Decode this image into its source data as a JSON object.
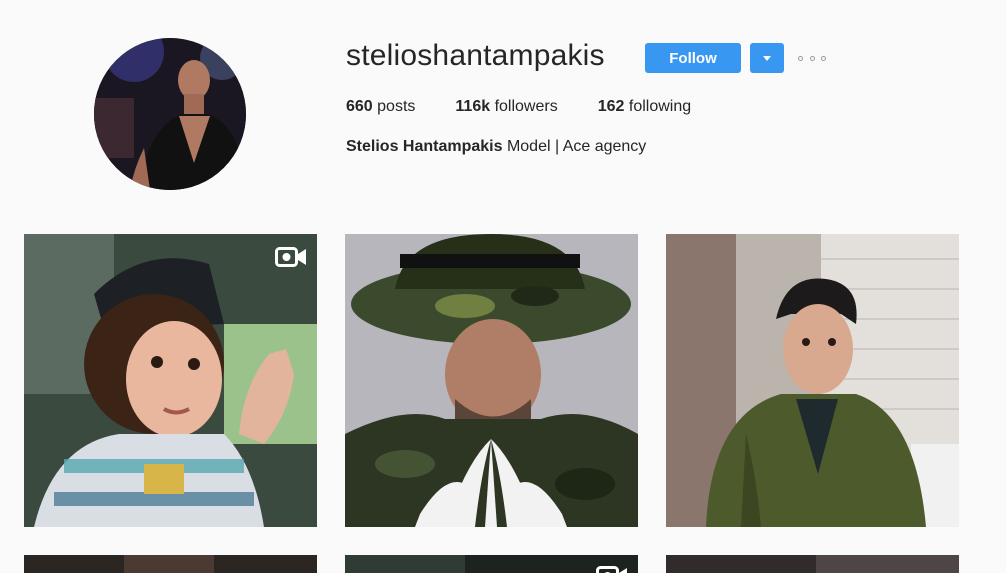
{
  "profile": {
    "username": "stelioshantampakis",
    "follow_label": "Follow",
    "posts_count": "660",
    "posts_label": "posts",
    "followers_count": "116k",
    "followers_label": "followers",
    "following_count": "162",
    "following_label": "following",
    "full_name": "Stelios Hantampakis",
    "bio": "Model | Ace agency"
  },
  "icons": {
    "dropdown": "caret-down-icon",
    "more": "more-options-icon",
    "video": "video-camera-icon"
  },
  "colors": {
    "accent": "#3897f0",
    "background": "#fafafa",
    "text": "#262626"
  }
}
